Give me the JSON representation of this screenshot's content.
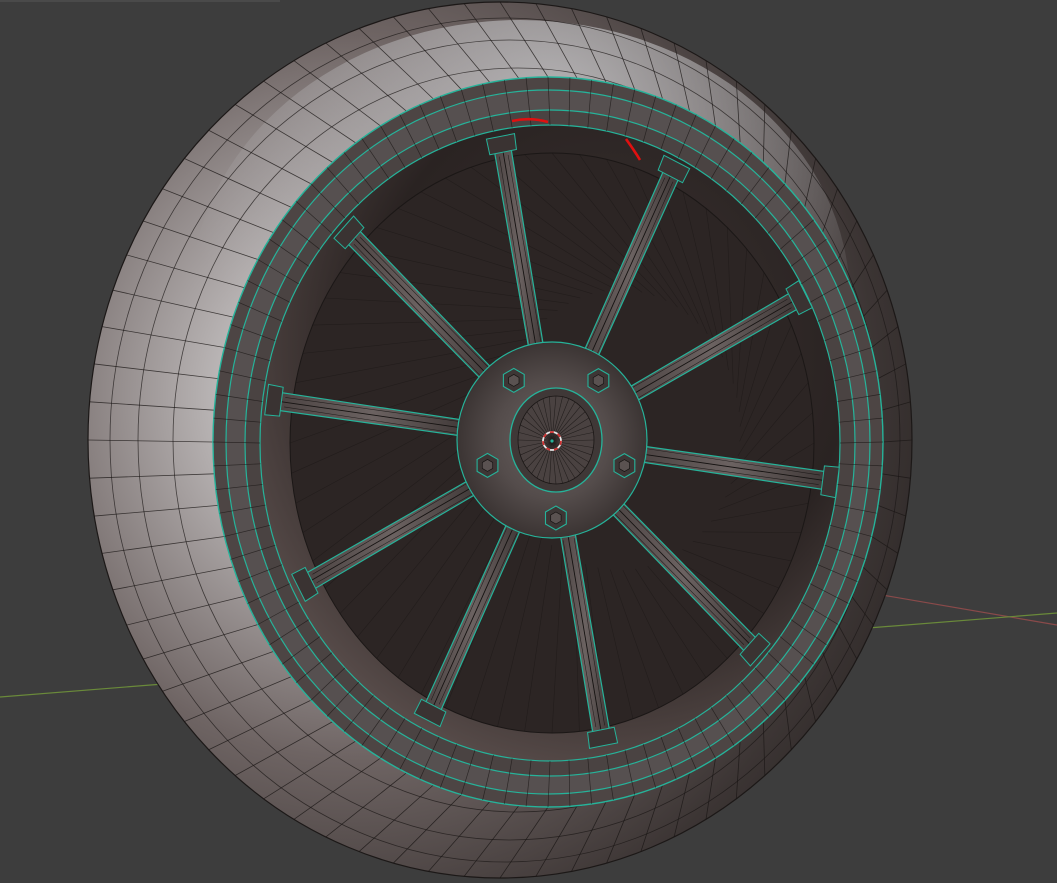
{
  "app": {
    "editor": "3D Viewport",
    "shading_mode": "solid",
    "object_mode": "edit"
  },
  "colors": {
    "background": "#3d3d3d",
    "tire_dark": "#2f2b2a",
    "tire_mid": "#6a6260",
    "tire_light": "#c9c7c8",
    "rim_metal": "#5d5554",
    "rim_shadow": "#3a3433",
    "selected_edge": "#26b39a",
    "wire_edge": "#161312",
    "x_axis": "#8a4a4a",
    "y_axis": "#6a8a3a",
    "seam_marker": "#e01010",
    "cursor_outer": "#e8e8e8",
    "cursor_inner": "#d03030"
  },
  "scene_objects": [
    {
      "name": "tire",
      "type": "mesh"
    },
    {
      "name": "rim",
      "type": "mesh",
      "spoke_count": 10
    },
    {
      "name": "hub",
      "type": "mesh",
      "lug_nut_count": 5
    },
    {
      "name": "3d-cursor",
      "type": "cursor"
    },
    {
      "name": "x-axis",
      "type": "grid-axis"
    },
    {
      "name": "y-axis",
      "type": "grid-axis"
    }
  ]
}
